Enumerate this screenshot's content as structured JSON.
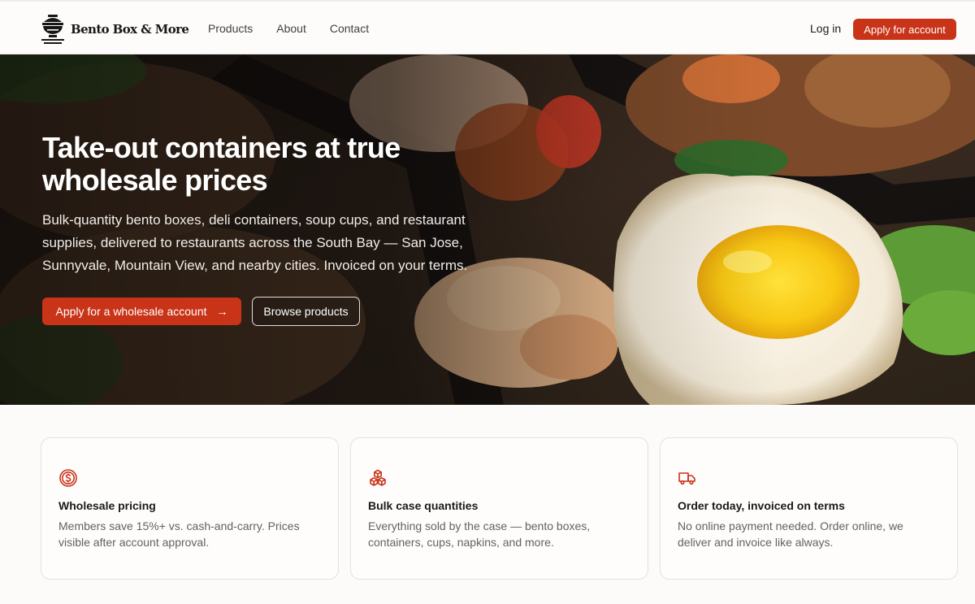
{
  "brand": {
    "name": "Bento Box & More",
    "accent": "#c93318"
  },
  "nav": {
    "links": [
      "Products",
      "About",
      "Contact"
    ],
    "login": "Log in",
    "apply": "Apply for account"
  },
  "hero": {
    "title": "Take-out containers at true wholesale prices",
    "subtitle": "Bulk-quantity bento boxes, deli containers, soup cups, and restaurant supplies, delivered to restaurants across the South Bay — San Jose, Sunnyvale, Mountain View, and nearby cities. Invoiced on your terms.",
    "primary_cta": "Apply for a wholesale account",
    "secondary_cta": "Browse products"
  },
  "features": [
    {
      "icon": "dollar-circle-icon",
      "title": "Wholesale pricing",
      "description": "Members save 15%+ vs. cash-and-carry. Prices visible after account approval."
    },
    {
      "icon": "boxes-icon",
      "title": "Bulk case quantities",
      "description": "Everything sold by the case — bento boxes, containers, cups, napkins, and more."
    },
    {
      "icon": "truck-icon",
      "title": "Order today, invoiced on terms",
      "description": "No online payment needed. Order online, we deliver and invoice like always."
    }
  ]
}
